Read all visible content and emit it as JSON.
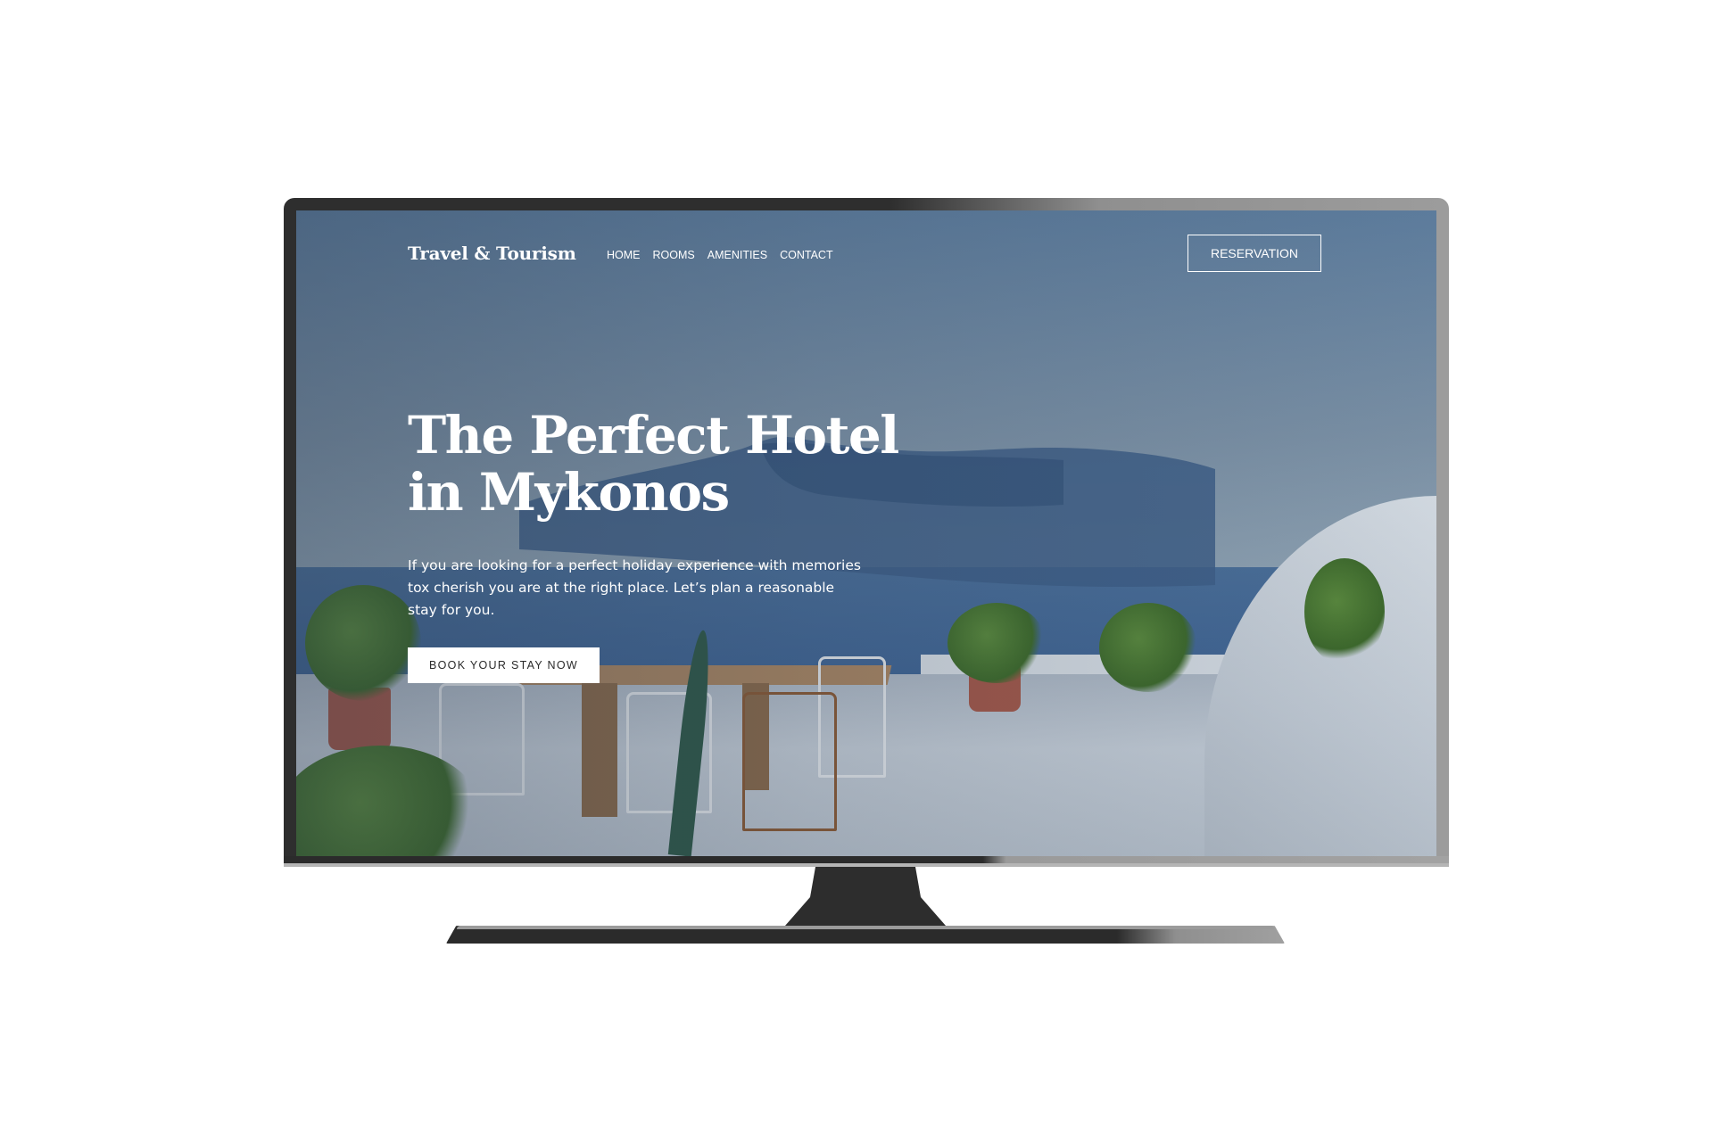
{
  "site": {
    "logo": "Travel & Tourism",
    "nav": [
      "HOME",
      "ROOMS",
      "AMENITIES",
      "CONTACT"
    ],
    "reservation_label": "RESERVATION"
  },
  "hero": {
    "title_line1": "The Perfect Hotel",
    "title_line2": "in Mykonos",
    "description": "If you are looking for a perfect holiday experience with memories tox cherish you are at the right place. Let’s plan a reasonable stay for you.",
    "cta_label": "BOOK YOUR STAY NOW"
  },
  "colors": {
    "monitor_dark": "#2e2e2e",
    "monitor_light": "#9c9c9c",
    "hero_text": "#ffffff",
    "cta_background": "#ffffff",
    "cta_text": "#2a2a2a"
  },
  "icons": {
    "device": "monitor-icon"
  }
}
